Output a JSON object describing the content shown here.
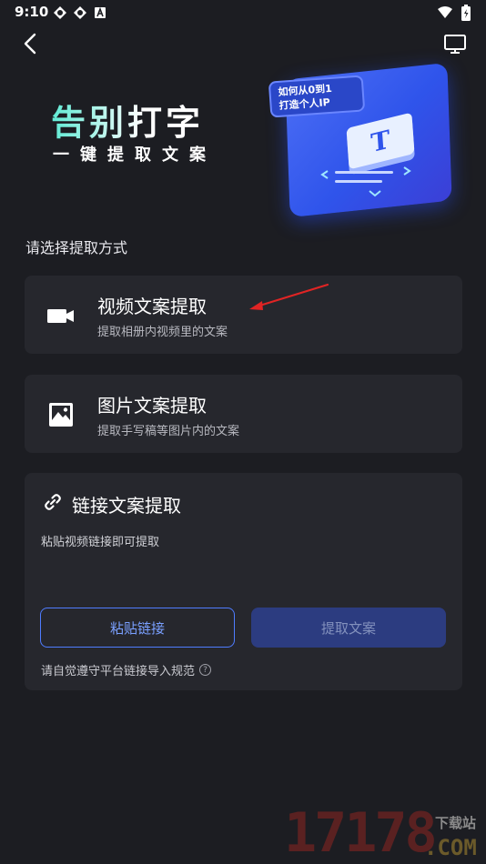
{
  "status_bar": {
    "time": "9:10",
    "left_icons": [
      "app-notification-icon",
      "app-notification-icon",
      "a-box-icon"
    ],
    "right_icons": [
      "wifi-icon",
      "battery-icon"
    ]
  },
  "nav": {
    "back_icon": "chevron-left-icon",
    "screen_icon": "monitor-icon"
  },
  "banner": {
    "title": "告别打字",
    "subtitle": "一键提取文案",
    "badge_line1": "如何从0到1",
    "badge_line2": "打造个人IP",
    "t_letter": "T"
  },
  "section_label": "请选择提取方式",
  "options": [
    {
      "icon": "video-camera-icon",
      "title": "视频文案提取",
      "desc": "提取相册内视频里的文案"
    },
    {
      "icon": "image-icon",
      "title": "图片文案提取",
      "desc": "提取手写稿等图片内的文案"
    }
  ],
  "link_card": {
    "icon": "link-icon",
    "title": "链接文案提取",
    "desc": "粘贴视频链接即可提取",
    "paste_label": "粘贴链接",
    "extract_label": "提取文案",
    "rules_note": "请自觉遵守平台链接导入规范",
    "help_symbol": "?"
  },
  "watermark": {
    "number": "17178",
    "site": "下载站",
    "domain": ".COM"
  },
  "colors": {
    "background": "#1c1d22",
    "card": "#26272d",
    "accent": "#4f7cff",
    "annotation_arrow": "#e02424"
  }
}
